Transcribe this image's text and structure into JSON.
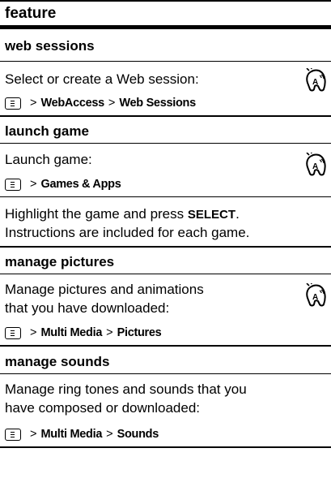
{
  "header": {
    "label": "feature"
  },
  "sections": {
    "web_sessions": {
      "title": "web sessions",
      "description": "Select or create a Web session:",
      "path": [
        "WebAccess",
        "Web Sessions"
      ],
      "icon": "network-feature-icon"
    },
    "launch_game": {
      "title": "launch game",
      "description": "Launch game:",
      "path": [
        "Games & Apps"
      ],
      "note_before": "Highlight the game and press",
      "note_key": "SELECT",
      "note_after": ".",
      "note_line2": "Instructions are included for each game.",
      "icon": "network-feature-icon"
    },
    "manage_pictures": {
      "title": "manage pictures",
      "description_line1": "Manage pictures and animations",
      "description_line2": "that you have downloaded:",
      "path": [
        "Multi Media",
        "Pictures"
      ],
      "icon": "network-feature-icon"
    },
    "manage_sounds": {
      "title": "manage sounds",
      "description_line1": "Manage ring tones and sounds that you",
      "description_line2": "have composed or downloaded:",
      "path": [
        "Multi Media",
        "Sounds"
      ]
    }
  },
  "separator": ">"
}
